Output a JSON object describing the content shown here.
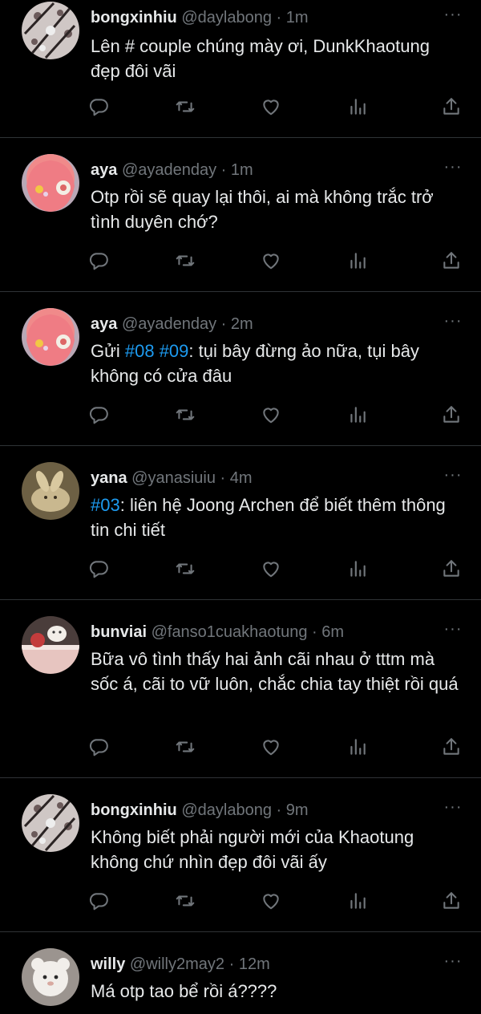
{
  "tweets": [
    {
      "name": "bongxinhiu",
      "handle": "@daylabong",
      "sep": "·",
      "time": "1m",
      "text_parts": [
        {
          "t": "Lên # couple chúng mày ơi, DunkKhaotung đẹp đôi vãi",
          "tag": false
        }
      ],
      "avatar": "avatar-flowers-dark"
    },
    {
      "name": "aya",
      "handle": "@ayadenday",
      "sep": "·",
      "time": "1m",
      "text_parts": [
        {
          "t": "Otp rồi sẽ quay lại thôi, ai mà không trắc trở tình duyên chớ?",
          "tag": false
        }
      ],
      "avatar": "avatar-pink-hair"
    },
    {
      "name": "aya",
      "handle": "@ayadenday",
      "sep": "·",
      "time": "2m",
      "text_parts": [
        {
          "t": "Gửi ",
          "tag": false
        },
        {
          "t": "#08",
          "tag": true
        },
        {
          "t": " ",
          "tag": false
        },
        {
          "t": "#09",
          "tag": true
        },
        {
          "t": ": tụi bây đừng ảo nữa, tụi bây không có cửa đâu",
          "tag": false
        }
      ],
      "avatar": "avatar-pink-hair"
    },
    {
      "name": "yana",
      "handle": "@yanasiuiu",
      "sep": "·",
      "time": "4m",
      "text_parts": [
        {
          "t": "#03",
          "tag": true
        },
        {
          "t": ": liên hệ Joong Archen để biết thêm thông tin chi tiết",
          "tag": false
        }
      ],
      "avatar": "avatar-beige-bunny"
    },
    {
      "name": "bunviai",
      "handle": "@fanso1cuakhaotung",
      "sep": "·",
      "time": "6m",
      "text_parts": [
        {
          "t": "Bữa vô tình thấy hai ảnh cãi nhau ở tttm mà sốc á, cãi to vữ luôn, chắc chia tay thiệt rồi quá",
          "tag": false
        }
      ],
      "avatar": "avatar-cake"
    },
    {
      "name": "bongxinhiu",
      "handle": "@daylabong",
      "sep": "·",
      "time": "9m",
      "text_parts": [
        {
          "t": "Không biết phải người mới của Khaotung không chứ nhìn đẹp đôi vãi ấy",
          "tag": false
        }
      ],
      "avatar": "avatar-flowers-dark"
    },
    {
      "name": "willy",
      "handle": "@willy2may2",
      "sep": "·",
      "time": "12m",
      "text_parts": [
        {
          "t": "Má otp tao bể rồi á????",
          "tag": false
        }
      ],
      "avatar": "avatar-white-toy"
    }
  ],
  "icons": {
    "reply": "reply-icon",
    "retweet": "retweet-icon",
    "like": "heart-icon",
    "stats": "stats-icon",
    "share": "share-icon",
    "more": "more-icon"
  },
  "more_glyph": "···",
  "colors": {
    "background": "#000000",
    "text": "#e7e9ea",
    "muted": "#71767b",
    "hashtag": "#1d9bf0",
    "divider": "#2f3336"
  }
}
